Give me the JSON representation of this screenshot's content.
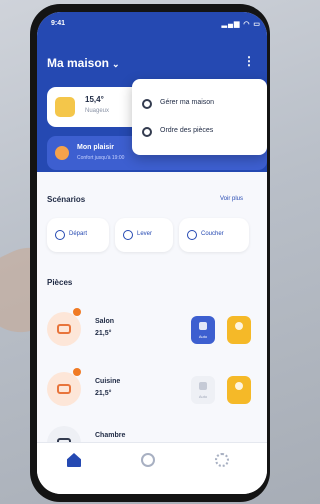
{
  "status_bar": {
    "time": "9:41",
    "icons": "signal wifi battery"
  },
  "header": {
    "home_title": "Ma maison",
    "menu_icon": "kebab-icon"
  },
  "weather": {
    "temperature": "15,4°",
    "description": "Nuageux"
  },
  "comfort": {
    "title": "Mon plaisir",
    "subtitle": "Confort jusqu'à 19:00"
  },
  "menu": {
    "items": [
      {
        "label": "Gérer ma maison",
        "icon": "home-settings-icon"
      },
      {
        "label": "Ordre des pièces",
        "icon": "reorder-icon"
      }
    ]
  },
  "scenarios": {
    "title": "Scénarios",
    "see_all": "Voir plus",
    "items": [
      {
        "label": "Départ",
        "icon": "departure-icon"
      },
      {
        "label": "Lever",
        "icon": "sunrise-icon"
      },
      {
        "label": "Coucher",
        "icon": "moon-icon"
      }
    ]
  },
  "rooms": {
    "title": "Pièces",
    "items": [
      {
        "name": "Salon",
        "temperature": "21,5°",
        "button_label": "Auto",
        "icon": "sofa-icon"
      },
      {
        "name": "Cuisine",
        "temperature": "21,5°",
        "button_label": "Auto",
        "icon": "kitchen-icon"
      },
      {
        "name": "Chambre",
        "temperature": "",
        "button_label": "",
        "icon": "bed-icon"
      }
    ]
  },
  "tabbar": {
    "items": [
      {
        "icon": "home-icon",
        "active": true
      },
      {
        "icon": "clock-icon",
        "active": false
      },
      {
        "icon": "settings-icon",
        "active": false
      }
    ]
  },
  "colors": {
    "primary": "#2549b2",
    "accent_orange": "#f07a24",
    "accent_yellow": "#f5b928"
  }
}
